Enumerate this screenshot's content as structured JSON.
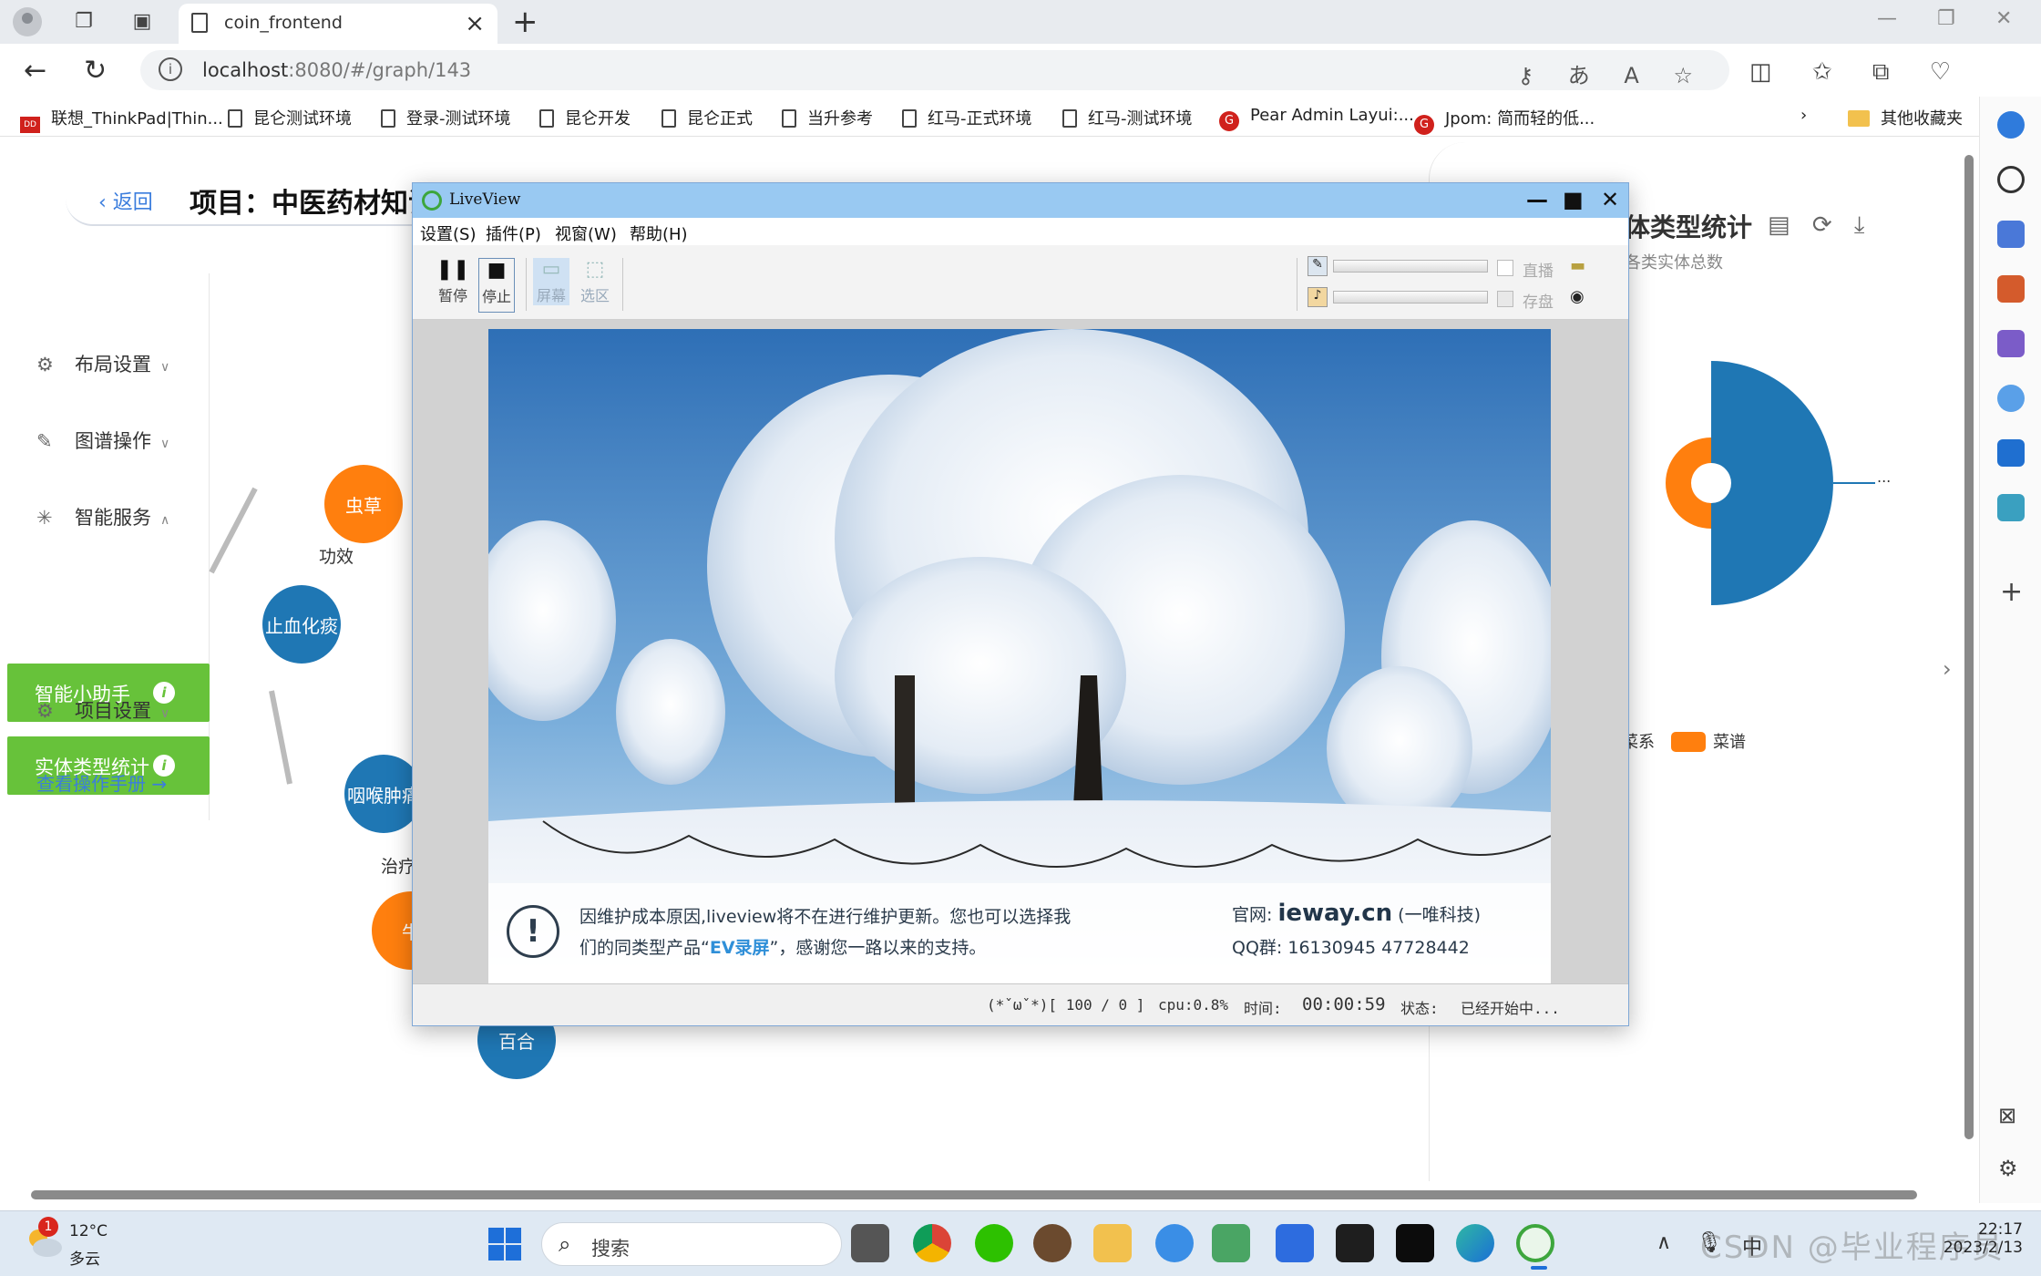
{
  "browser": {
    "tab_title": "coin_frontend",
    "url_host": "localhost",
    "url_rest": ":8080/#/graph/143",
    "bookmarks": [
      {
        "label": "联想_ThinkPad|Thin...",
        "icon": "lenovo-icon"
      },
      {
        "label": "昆仑测试环境",
        "icon": "doc-icon"
      },
      {
        "label": "登录-测试环境",
        "icon": "doc-icon"
      },
      {
        "label": "昆仑开发",
        "icon": "doc-icon"
      },
      {
        "label": "昆仑正式",
        "icon": "doc-icon"
      },
      {
        "label": "当升参考",
        "icon": "doc-icon"
      },
      {
        "label": "红马-正式环境",
        "icon": "doc-icon"
      },
      {
        "label": "红马-测试环境",
        "icon": "doc-icon"
      },
      {
        "label": "Pear Admin Layui:...",
        "icon": "g-icon"
      },
      {
        "label": "Jpom: 简而轻的低...",
        "icon": "g-icon"
      }
    ],
    "other_bookmarks": "其他收藏夹"
  },
  "page": {
    "back_label": "返回",
    "project_title": "项目：中医药材知识",
    "menu": {
      "layout": "布局设置",
      "graph_ops": "图谱操作",
      "smart": "智能服务",
      "assistant": "智能小助手",
      "entity_stats": "实体类型统计",
      "project_settings": "项目设置",
      "manual": "查看操作手册 →"
    },
    "graph": {
      "nodes": [
        "虫草",
        "止血化痰",
        "咽喉肿痛",
        "牛",
        "百合"
      ],
      "edges": [
        "功效",
        "治疗"
      ]
    },
    "right_panel": {
      "title": "体类型统计",
      "subtitle": "各类实体总数",
      "legend": [
        {
          "label": "菜系",
          "color": "#1f77b4"
        },
        {
          "label": "菜谱",
          "color": "#ff7f0e"
        }
      ],
      "more": "..."
    }
  },
  "liveview": {
    "title": "LiveView",
    "menu": [
      "设置(S)",
      "插件(P)",
      "视窗(W)",
      "帮助(H)"
    ],
    "tools": {
      "pause": "暂停",
      "stop": "停止",
      "screen": "屏幕",
      "region": "选区"
    },
    "options": {
      "live": "直播",
      "save": "存盘"
    },
    "notice_line1": "因维护成本原因,liveview将不在进行维护更新。您也可以选择我",
    "notice_line2_a": "们的同类型产品“",
    "notice_line2_ev": "EV录屏",
    "notice_line2_b": "”，感谢您一路以来的支持。",
    "site_label": "官网:",
    "site_value": "ieway.cn",
    "site_suffix": "(一唯科技)",
    "qq": "QQ群: 16130945 47728442",
    "status": {
      "face": "(*ˇωˇ*)[ 100 / 0 ]",
      "cpu": "cpu:0.8%",
      "time_label": "时间:",
      "time_value": "00:00:59",
      "state_label": "状态:",
      "state_value": "已经开始中..."
    }
  },
  "taskbar": {
    "temp": "12°C",
    "weather": "多云",
    "badge": "1",
    "search": "搜索",
    "time": "22:17",
    "date": "2023/2/13",
    "watermark": "CSDN @毕业程序员"
  },
  "colors": {
    "accent_blue": "#3b7ddd",
    "green": "#67c23a",
    "node_orange": "#ff7f0e",
    "node_blue": "#1f77b4",
    "lv_title": "#99c9f2"
  }
}
